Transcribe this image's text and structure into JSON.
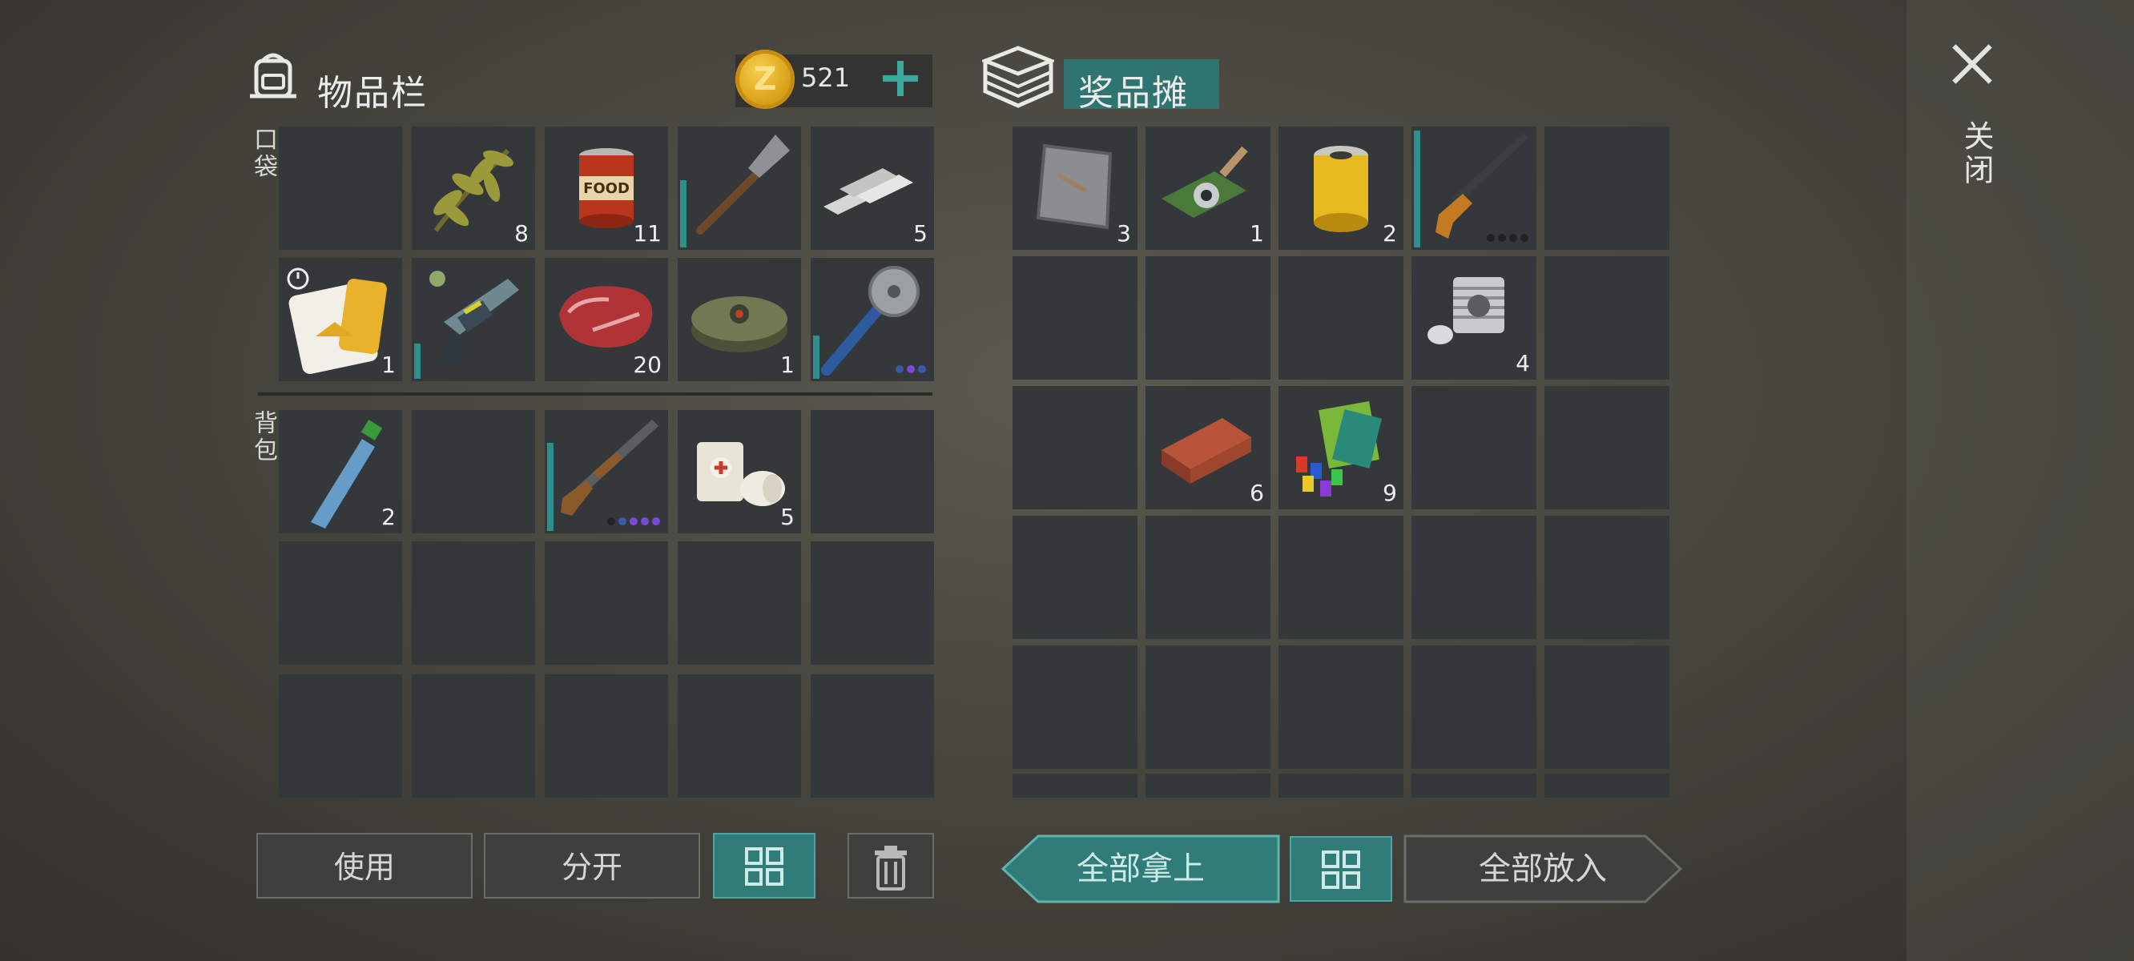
{
  "inventory": {
    "title": "物品栏",
    "coins": "521",
    "pocket_label": "口袋",
    "backpack_label": "背包",
    "pocket_counts": [
      "",
      "8",
      "11",
      "",
      "5",
      "1",
      "",
      "20",
      "1",
      ""
    ],
    "backpack_counts": [
      "2",
      "",
      "",
      "5",
      ""
    ],
    "buttons": {
      "use": "使用",
      "split": "分开"
    }
  },
  "stall": {
    "title": "奖品摊",
    "counts": [
      "3",
      "1",
      "2",
      "",
      "4",
      "6",
      "9"
    ],
    "buttons": {
      "take_all": "全部拿上",
      "put_all": "全部放入"
    }
  },
  "close_label": "关闭",
  "colors": {
    "accent": "#2f7c78",
    "slot": "#34383a",
    "coin": "#e2aa22"
  }
}
